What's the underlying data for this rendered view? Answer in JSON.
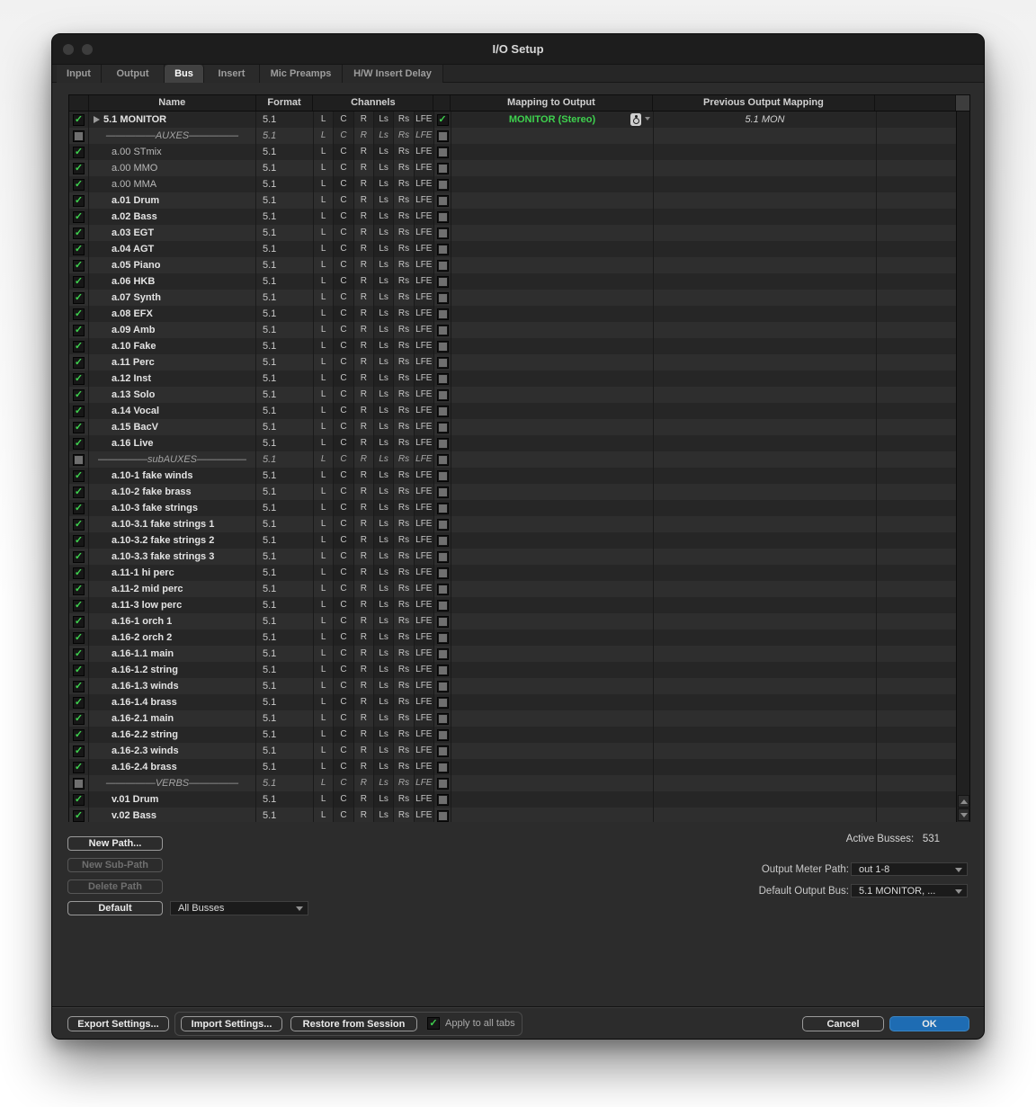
{
  "colors": {
    "accent_green": "#3ed14e",
    "ok_blue": "#1e6cb3"
  },
  "window": {
    "title": "I/O Setup"
  },
  "tabs": {
    "items": [
      {
        "label": "Input",
        "active": false
      },
      {
        "label": "Output",
        "active": false
      },
      {
        "label": "Bus",
        "active": true
      },
      {
        "label": "Insert",
        "active": false
      },
      {
        "label": "Mic Preamps",
        "active": false
      },
      {
        "label": "H/W Insert Delay",
        "active": false
      }
    ]
  },
  "table": {
    "headers": {
      "name": "Name",
      "format": "Format",
      "channels": "Channels",
      "mapping": "Mapping to Output",
      "previous": "Previous Output Mapping"
    },
    "channel_labels": [
      "L",
      "C",
      "R",
      "Ls",
      "Rs",
      "LFE"
    ],
    "rows": [
      {
        "name": "5.1 MONITOR",
        "format": "5.1",
        "checked": true,
        "expandable": true,
        "map_checked": true,
        "mapping": "MONITOR (Stereo)",
        "previous": "5.1 MON"
      },
      {
        "name": "—————AUXES—————",
        "format": "5.1",
        "divider": true
      },
      {
        "name": "a.00 STmix",
        "format": "5.1",
        "checked": true,
        "dim": true
      },
      {
        "name": "a.00 MMO",
        "format": "5.1",
        "checked": true,
        "dim": true
      },
      {
        "name": "a.00 MMA",
        "format": "5.1",
        "checked": true,
        "dim": true
      },
      {
        "name": "a.01 Drum",
        "format": "5.1",
        "checked": true
      },
      {
        "name": "a.02 Bass",
        "format": "5.1",
        "checked": true
      },
      {
        "name": "a.03 EGT",
        "format": "5.1",
        "checked": true
      },
      {
        "name": "a.04 AGT",
        "format": "5.1",
        "checked": true
      },
      {
        "name": "a.05 Piano",
        "format": "5.1",
        "checked": true
      },
      {
        "name": "a.06 HKB",
        "format": "5.1",
        "checked": true
      },
      {
        "name": "a.07 Synth",
        "format": "5.1",
        "checked": true
      },
      {
        "name": "a.08 EFX",
        "format": "5.1",
        "checked": true
      },
      {
        "name": "a.09 Amb",
        "format": "5.1",
        "checked": true
      },
      {
        "name": "a.10 Fake",
        "format": "5.1",
        "checked": true
      },
      {
        "name": "a.11 Perc",
        "format": "5.1",
        "checked": true
      },
      {
        "name": "a.12 Inst",
        "format": "5.1",
        "checked": true
      },
      {
        "name": "a.13 Solo",
        "format": "5.1",
        "checked": true
      },
      {
        "name": "a.14 Vocal",
        "format": "5.1",
        "checked": true
      },
      {
        "name": "a.15 BacV",
        "format": "5.1",
        "checked": true
      },
      {
        "name": "a.16 Live",
        "format": "5.1",
        "checked": true
      },
      {
        "name": "—————subAUXES—————",
        "format": "5.1",
        "divider": true
      },
      {
        "name": "a.10-1 fake winds",
        "format": "5.1",
        "checked": true
      },
      {
        "name": "a.10-2 fake brass",
        "format": "5.1",
        "checked": true
      },
      {
        "name": "a.10-3 fake strings",
        "format": "5.1",
        "checked": true
      },
      {
        "name": "a.10-3.1 fake strings 1",
        "format": "5.1",
        "checked": true
      },
      {
        "name": "a.10-3.2 fake strings 2",
        "format": "5.1",
        "checked": true
      },
      {
        "name": "a.10-3.3 fake strings 3",
        "format": "5.1",
        "checked": true
      },
      {
        "name": "a.11-1 hi perc",
        "format": "5.1",
        "checked": true
      },
      {
        "name": "a.11-2 mid perc",
        "format": "5.1",
        "checked": true
      },
      {
        "name": "a.11-3 low perc",
        "format": "5.1",
        "checked": true
      },
      {
        "name": "a.16-1 orch 1",
        "format": "5.1",
        "checked": true
      },
      {
        "name": "a.16-2 orch 2",
        "format": "5.1",
        "checked": true
      },
      {
        "name": "a.16-1.1 main",
        "format": "5.1",
        "checked": true
      },
      {
        "name": "a.16-1.2 string",
        "format": "5.1",
        "checked": true
      },
      {
        "name": "a.16-1.3 winds",
        "format": "5.1",
        "checked": true
      },
      {
        "name": "a.16-1.4 brass",
        "format": "5.1",
        "checked": true
      },
      {
        "name": "a.16-2.1 main",
        "format": "5.1",
        "checked": true
      },
      {
        "name": "a.16-2.2 string",
        "format": "5.1",
        "checked": true
      },
      {
        "name": "a.16-2.3 winds",
        "format": "5.1",
        "checked": true
      },
      {
        "name": "a.16-2.4 brass",
        "format": "5.1",
        "checked": true
      },
      {
        "name": "—————VERBS—————",
        "format": "5.1",
        "divider": true
      },
      {
        "name": "v.01 Drum",
        "format": "5.1",
        "checked": true
      },
      {
        "name": "v.02 Bass",
        "format": "5.1",
        "checked": true
      }
    ]
  },
  "path_controls": {
    "new_path": "New Path...",
    "new_sub_path": "New Sub-Path",
    "delete_path": "Delete Path",
    "default": "Default",
    "filter_value": "All Busses"
  },
  "status": {
    "active_busses_label": "Active Busses:",
    "active_busses_value": "531",
    "output_meter_label": "Output Meter Path:",
    "output_meter_value": "out 1-8",
    "default_output_label": "Default Output Bus:",
    "default_output_value": "5.1 MONITOR, ..."
  },
  "bottom_bar": {
    "export": "Export Settings...",
    "import": "Import Settings...",
    "restore": "Restore from Session",
    "apply_label": "Apply to all tabs",
    "apply_checked": true,
    "cancel": "Cancel",
    "ok": "OK"
  }
}
